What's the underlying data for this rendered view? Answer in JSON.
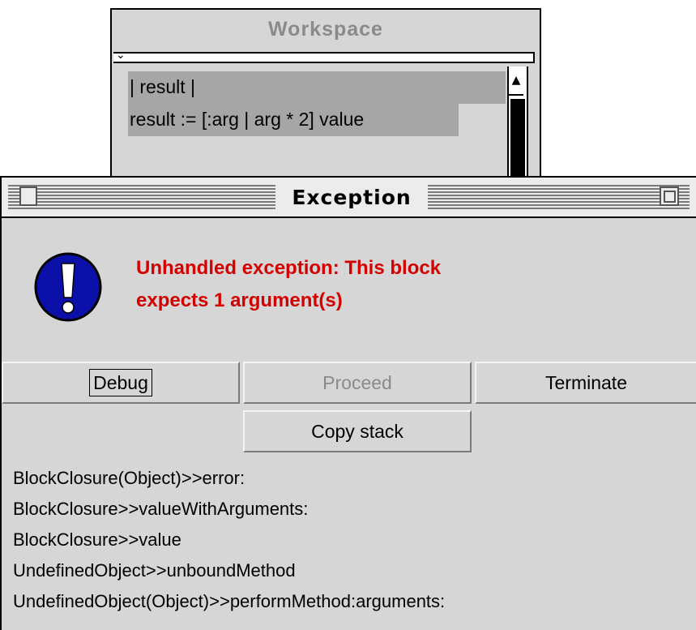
{
  "workspace": {
    "title": "Workspace",
    "code": [
      "| result |",
      "result := [:arg | arg * 2] value"
    ]
  },
  "exception": {
    "title": "Exception",
    "message_line1": "Unhandled exception: This block",
    "message_line2": "expects 1 argument(s)",
    "buttons": {
      "debug": "Debug",
      "proceed": "Proceed",
      "terminate": "Terminate",
      "copy_stack": "Copy stack"
    },
    "stack": [
      "BlockClosure(Object)>>error:",
      "BlockClosure>>valueWithArguments:",
      "BlockClosure>>value",
      "UndefinedObject>>unboundMethod",
      "UndefinedObject(Object)>>performMethod:arguments:"
    ]
  },
  "colors": {
    "message": "#d40000",
    "icon_fill": "#0a10a8",
    "window_bg": "#d6d6d6"
  },
  "icons": {
    "alert": "exclamation-circle-icon",
    "chevron": "chevron-down-icon",
    "scroll_up": "up-arrow-icon"
  }
}
